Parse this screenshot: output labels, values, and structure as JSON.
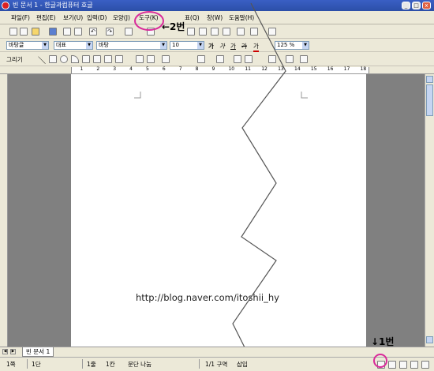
{
  "window": {
    "title": "빈 문서 1 - 한글과컴퓨터 호글"
  },
  "menu": [
    {
      "label": "파일(F)"
    },
    {
      "label": "편집(E)"
    },
    {
      "label": "보기(U)"
    },
    {
      "label": "입력(D)"
    },
    {
      "label": "모양(J)"
    },
    {
      "label": "도구(K)"
    },
    {
      "label": "표(Q)"
    },
    {
      "label": "창(W)"
    },
    {
      "label": "도움말(H)"
    }
  ],
  "format_bar": {
    "style": "바탕글",
    "lang": "대표",
    "font": "바탕",
    "size": "10",
    "bold": "가",
    "italic": "가",
    "underline": "가",
    "strike": "가",
    "color_letter": "가",
    "zoom": "125 %"
  },
  "draw_bar": {
    "label": "그리기"
  },
  "ruler": {
    "marks": [
      "1",
      "2",
      "3",
      "4",
      "5",
      "6",
      "7",
      "8",
      "9",
      "10",
      "11",
      "12",
      "13",
      "14",
      "15",
      "16",
      "17",
      "18"
    ]
  },
  "document": {
    "url_text": "http://blog.naver.com/itoshii_hy"
  },
  "tabs": [
    {
      "label": "빈 문서 1"
    }
  ],
  "status": {
    "page": "1쪽",
    "section": "1단",
    "line": "1줄",
    "column": "1칸",
    "break": "문단 나눔",
    "pos": "1/1 구역",
    "mode": "삽입"
  },
  "annotations": {
    "label_2": "←2번",
    "label_1": "↓1번"
  },
  "colors": {
    "highlight": "#d92a9a",
    "titlebar": "#2c4fa8"
  }
}
